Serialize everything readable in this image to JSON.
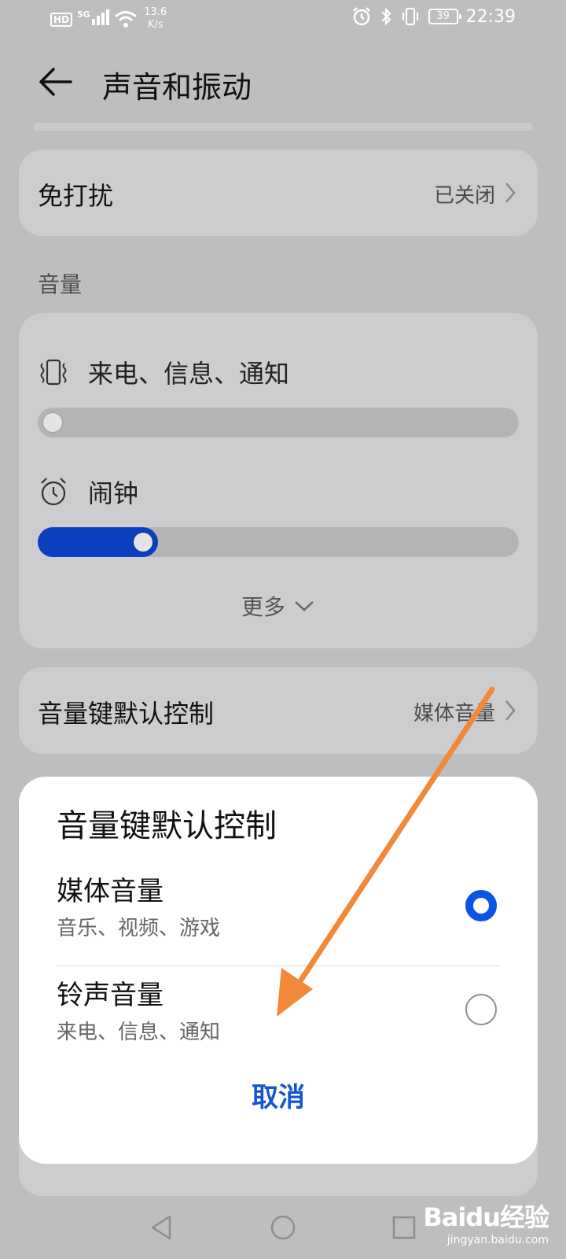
{
  "status_bar": {
    "hd": "HD",
    "signal": "5G",
    "net_speed_value": "13.6",
    "net_speed_unit": "K/s",
    "battery": "39",
    "time": "22:39"
  },
  "header": {
    "title": "声音和振动"
  },
  "dnd": {
    "label": "免打扰",
    "value": "已关闭"
  },
  "volume": {
    "section_title": "音量",
    "items": [
      {
        "label": "来电、信息、通知",
        "icon": "vibrate-icon",
        "level": 0.0
      },
      {
        "label": "闹钟",
        "icon": "alarm-icon",
        "level": 0.25
      }
    ],
    "more_label": "更多"
  },
  "volume_key": {
    "label": "音量键默认控制",
    "value": "媒体音量"
  },
  "dialog": {
    "title": "音量键默认控制",
    "options": [
      {
        "title": "媒体音量",
        "subtitle": "音乐、视频、游戏",
        "selected": true
      },
      {
        "title": "铃声音量",
        "subtitle": "来电、信息、通知",
        "selected": false
      }
    ],
    "cancel_label": "取消"
  },
  "colors": {
    "accent": "#0a55e6",
    "slider_fill": "#0a3fbf",
    "annotation_arrow": "#f08a3a"
  },
  "watermark": {
    "main": "Baidu经验",
    "sub": "jingyan.baidu.com"
  }
}
